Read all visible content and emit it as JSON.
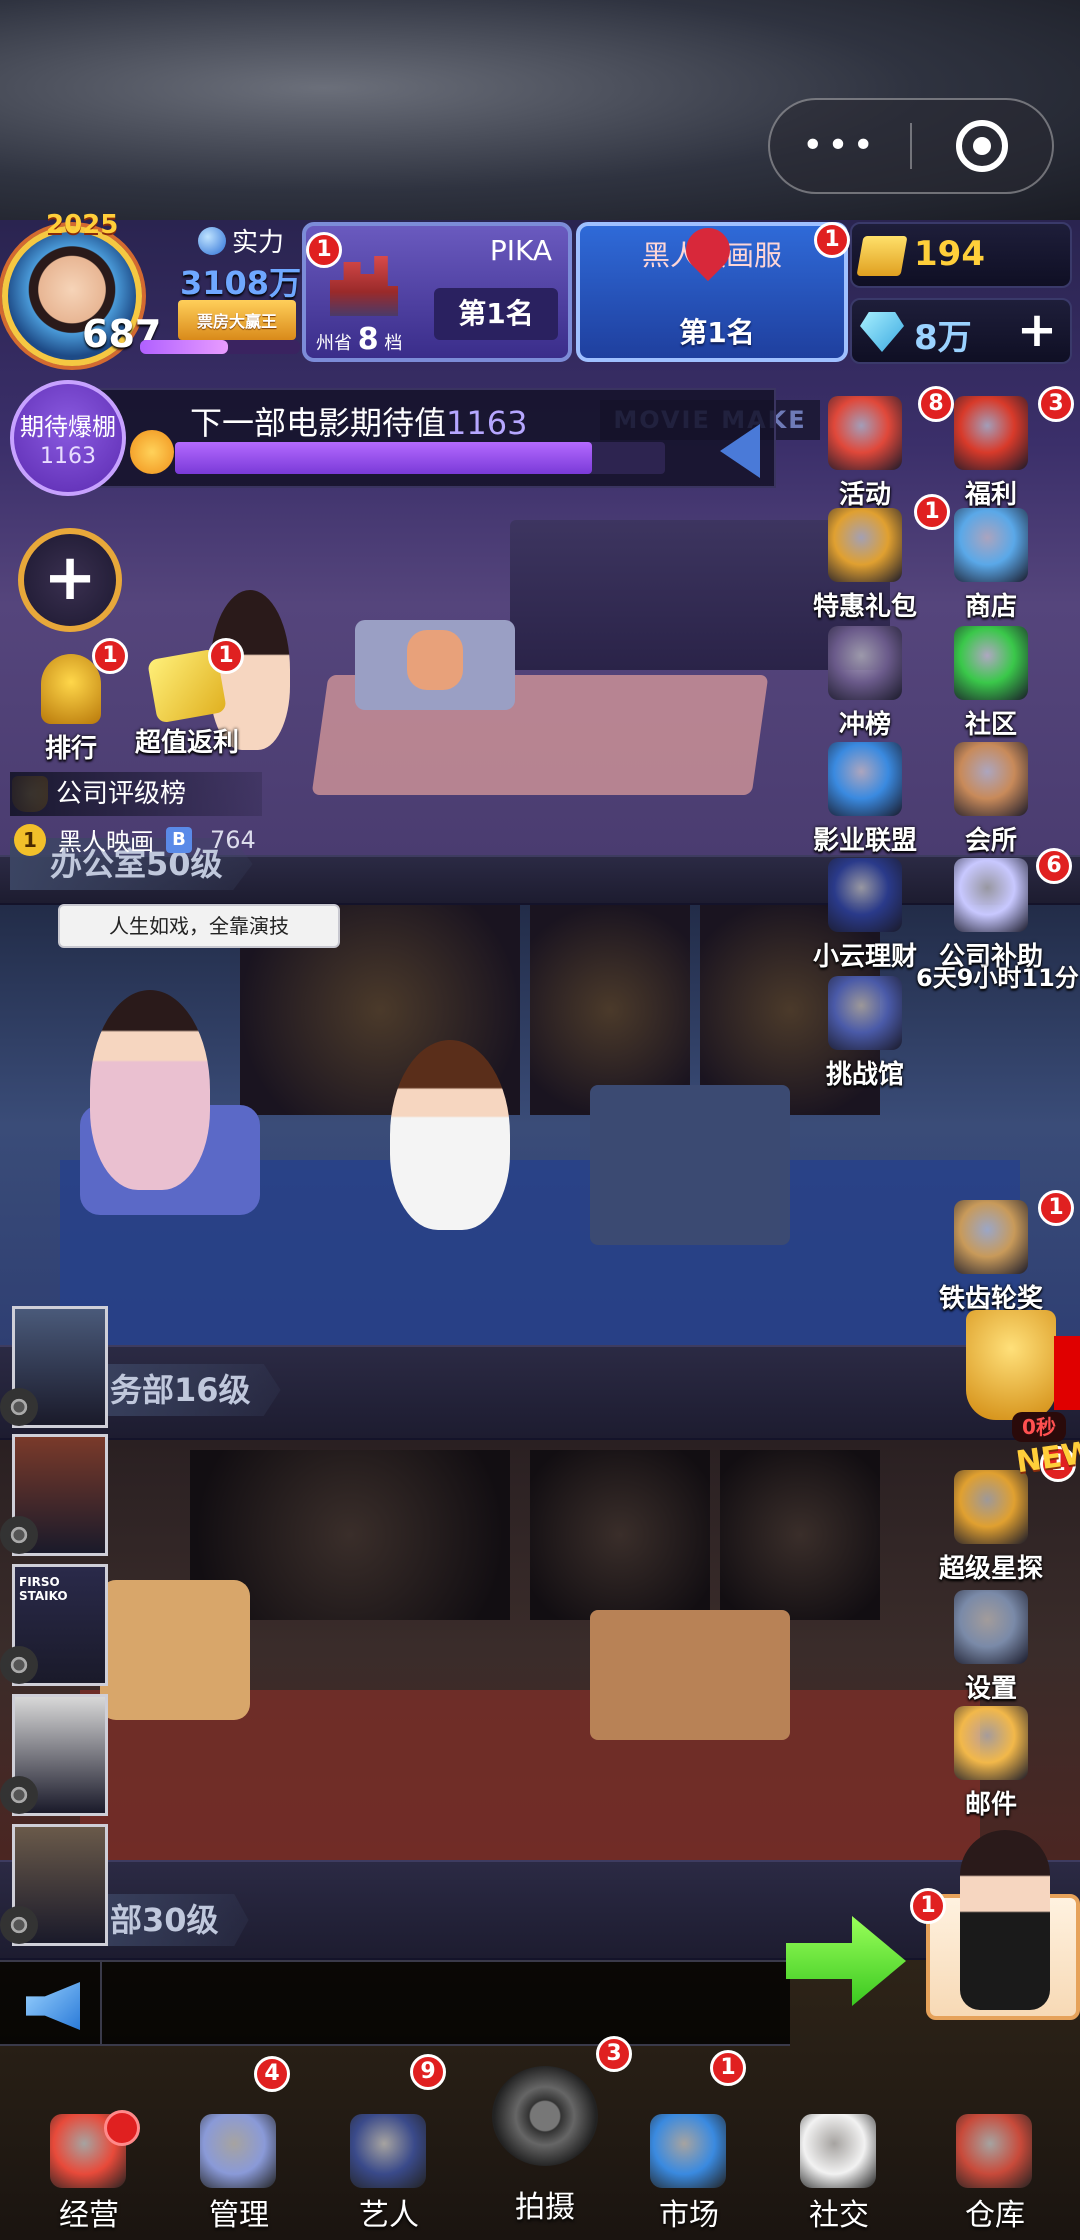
{
  "hud": {
    "capsule": {
      "more": "•••"
    },
    "player": {
      "year": "2025",
      "level": "687",
      "power_label": "实力",
      "power_value": "3108万",
      "power_badge": "票房大赢王",
      "xp_fraction": 0.55
    },
    "city_rank": {
      "title": "PIKA",
      "region": "州省",
      "tier_num": "8",
      "tier_unit": "档",
      "place": "第1名",
      "badge": "1"
    },
    "server_rank": {
      "title": "黑人映画服",
      "place": "第1名",
      "badge": "1"
    },
    "resources": {
      "tickets": "194",
      "gems": "8万"
    },
    "expectation": {
      "circle_title": "期待爆棚",
      "circle_value": "1163",
      "label": "下一部电影期待值",
      "value": "1163",
      "fill_fraction": 0.85
    }
  },
  "lobby": {
    "sign": "MOVIE MAKE"
  },
  "left_buttons": [
    {
      "label": "排行",
      "badge": "1"
    },
    {
      "label": "超值返利",
      "badge": "1"
    }
  ],
  "right_buttons": [
    {
      "label": "活动",
      "badge": "8"
    },
    {
      "label": "福利",
      "badge": "3"
    },
    {
      "label": "特惠礼包",
      "badge": "1"
    },
    {
      "label": "商店",
      "badge": ""
    },
    {
      "label": "冲榜",
      "badge": ""
    },
    {
      "label": "社区",
      "badge": ""
    },
    {
      "label": "影业联盟",
      "badge": ""
    },
    {
      "label": "会所",
      "badge": ""
    },
    {
      "label": "小云理财",
      "badge": ""
    },
    {
      "label": "公司补助",
      "badge": "6"
    },
    {
      "label": "挑战馆",
      "badge": ""
    },
    {
      "label": "铁齿轮奖",
      "badge": "1"
    },
    {
      "label": "超级星探",
      "badge": "1"
    },
    {
      "label": "设置",
      "badge": ""
    },
    {
      "label": "邮件",
      "badge": ""
    }
  ],
  "subsidy_countdown": "6天9小时11分",
  "company_rank": {
    "title": "公司评级榜",
    "first_place_num": "1",
    "first_place_name": "黑人映画",
    "b_letter": "B",
    "score": "764"
  },
  "floors": [
    {
      "label": "办公室50级"
    },
    {
      "label": "务部16级"
    },
    {
      "label": "部30级"
    }
  ],
  "speech_bubble": "人生如戏，全靠演技",
  "trophy_timer": "0秒",
  "new_tag": "NEW",
  "posters": [
    {
      "caption": ""
    },
    {
      "caption": ""
    },
    {
      "caption": "FIRSO STAIKO"
    },
    {
      "caption": ""
    },
    {
      "caption": ""
    }
  ],
  "assistant_badge": "1",
  "tabbar": [
    {
      "label": "经营",
      "badge": ""
    },
    {
      "label": "管理",
      "badge": "4"
    },
    {
      "label": "艺人",
      "badge": "9"
    },
    {
      "label": "拍摄",
      "badge": "3"
    },
    {
      "label": "市场",
      "badge": "1"
    },
    {
      "label": "社交",
      "badge": ""
    },
    {
      "label": "仓库",
      "badge": ""
    }
  ],
  "colors": {
    "badge_red": "#e02020",
    "accent_purple": "#7a3ad8",
    "gold": "#ffcf3a"
  }
}
